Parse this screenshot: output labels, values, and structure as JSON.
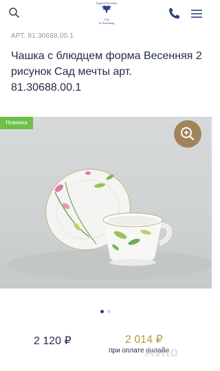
{
  "header": {
    "logo_text_top": "Imperial Porcelain",
    "logo_year": "1744",
    "logo_city": "St. Petersburg"
  },
  "product": {
    "sku": "АРТ. 81.30688.00.1",
    "title": "Чашка с блюдцем форма Весенняя 2 рисунок Сад мечты арт. 81.30688.00.1",
    "badge": "Новинка"
  },
  "gallery": {
    "slides": 2,
    "active_slide": 1
  },
  "prices": {
    "regular": "2 120 ₽",
    "online": "2 014 ₽",
    "online_note": "при оплате онлайн"
  },
  "watermark": "Avito",
  "colors": {
    "navy": "#1f2a44",
    "gold": "#b89a2e",
    "badge_green": "#6cc04a",
    "zoom_brown": "#a1845a"
  }
}
